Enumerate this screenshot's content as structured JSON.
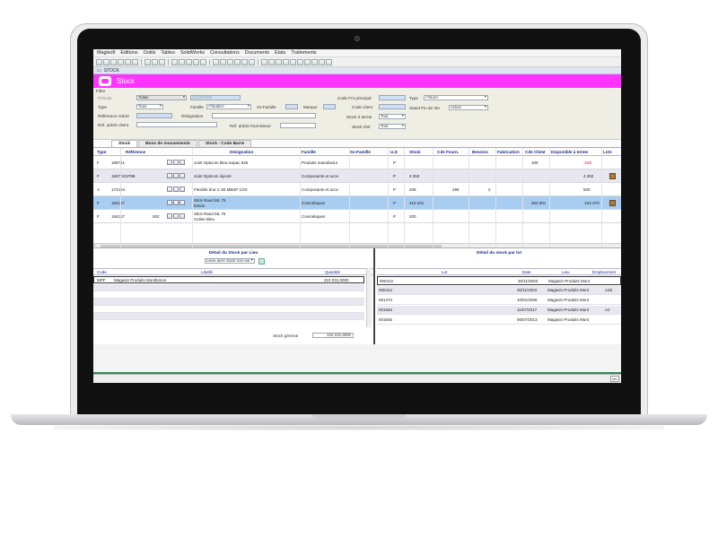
{
  "menu": [
    "Magisoft",
    "Editions",
    "Outils",
    "Tables",
    "SolidWorks",
    "Consultations",
    "Documents",
    "Etats",
    "Traitements"
  ],
  "window_title": "STOCK",
  "banner_title": "Stock",
  "filter": {
    "title": "Filtre",
    "periode_label": "Période",
    "periode_value": "Totale",
    "date_value": "31/12/2009",
    "code_fnr_label": "Code Fnr principal",
    "type_label": "Type",
    "type_value": "Tous",
    "famille_label": "Famille",
    "famille_value": "<Toutes>",
    "sous_famille_label": "Ss-Famille",
    "marque_label": "Marque",
    "code_client_label": "Code client",
    "type2_label": "Type",
    "type2_value": "<Tous>",
    "statut_label": "Statut Fin de Vie",
    "statut_value": "Active",
    "ref_article_label": "Référence Article",
    "designation_label": "Désignation",
    "stock_terme_label": "Stock à terme",
    "stock_terme_value": "Tout",
    "ref_client_label": "Ref. article client",
    "ref_fournisseur_label": "Ref. article fournisseur",
    "stock_reel_label": "Stock réel",
    "stock_reel_value": "Tout"
  },
  "tabs": [
    "Stock",
    "Bons de mouvements",
    "Stock - Code Barre"
  ],
  "grid": {
    "headers": [
      "Type",
      "Référence",
      "Désignation",
      "Famille",
      "Ss-Famille",
      "U.D",
      "Stock",
      "Cde Fourn.",
      "Besoins",
      "Fabrication",
      "Cde Client",
      "Disponible à terme",
      "Lots"
    ],
    "rows": [
      {
        "type": "F",
        "ref": "169751",
        "ref2": "",
        "designation": "Joint Opticom bleu isopac 525",
        "designation2": "",
        "famille": "Produits manufactur",
        "ud": "P",
        "stock": "",
        "cde_fourn": "",
        "besoins": "",
        "fabrication": "",
        "cde_client": "100",
        "dispo": "-100",
        "dispo_negative": true,
        "lots": false
      },
      {
        "type": "F",
        "ref": "1697A01P0B",
        "ref2": "",
        "designation": "Joint Opticom injecté",
        "designation2": "",
        "famille": "Composants et acce",
        "ud": "P",
        "stock": "4 250",
        "cde_fourn": "",
        "besoins": "",
        "fabrication": "",
        "cde_client": "",
        "dispo": "4 250",
        "dispo_negative": false,
        "lots": true
      },
      {
        "type": "A",
        "ref": "172464",
        "ref2": "",
        "designation": "Flexible brut C 90 MBSP 1/2X",
        "designation2": "",
        "famille": "Composants et acce",
        "ud": "P",
        "stock": "208",
        "cde_fourn": "296",
        "besoins": "2",
        "fabrication": "",
        "cde_client": "",
        "dispo": "500",
        "dispo_negative": false,
        "lots": false
      },
      {
        "type": "F",
        "ref": "184187",
        "ref2": "",
        "designation": "Stick Rand ML 75",
        "designation2": "Estine",
        "famille": "Cosmétiques",
        "ud": "P",
        "stock": "210 231",
        "cde_fourn": "",
        "besoins": "",
        "fabrication": "",
        "cde_client": "362 901",
        "dispo": "-152 670",
        "dispo_negative": false,
        "lots": true
      },
      {
        "type": "F",
        "ref": "184187",
        "ref2": "002",
        "designation": "Stick Rand ML 75",
        "designation2": "Celine Bleu",
        "famille": "Cosmétiques",
        "ud": "P",
        "stock": "200",
        "cde_fourn": "",
        "besoins": "",
        "fabrication": "",
        "cde_client": "",
        "dispo": "",
        "dispo_negative": false,
        "lots": false
      }
    ]
  },
  "detail_lieu": {
    "title": "Détail du Stock par Lieu",
    "filter_value": "Lieux avec stock non-nul",
    "headers": [
      "Code",
      "Libellé",
      "Quantité"
    ],
    "rows": [
      {
        "code": "MPF",
        "libelle": "Magasin Produits Montbrison",
        "quantite": "210 231,0000"
      }
    ],
    "total_label": "Stock général",
    "total_value": "210 231,0000"
  },
  "detail_lot": {
    "title": "Détail du stock par lot",
    "headers": [
      "Lot",
      "Date",
      "Lieu",
      "Emplacemen"
    ],
    "rows": [
      {
        "lot": "000412",
        "date": "30/11/2003",
        "lieu": "Magasin Produits Mont",
        "emplacement": ""
      },
      {
        "lot": "000412",
        "date": "30/11/2003",
        "lieu": "Magasin Produits Mont",
        "emplacement": "A28"
      },
      {
        "lot": "001473",
        "date": "10/01/2008",
        "lieu": "Magasin Produits Mont",
        "emplacement": ""
      },
      {
        "lot": "001846",
        "date": "11/07/2017",
        "lieu": "Magasin Produits Mont",
        "emplacement": "A2"
      },
      {
        "lot": "001846",
        "date": "06/07/2013",
        "lieu": "Magasin Produits Mont",
        "emplacement": ""
      }
    ]
  },
  "status": {
    "key_label": "Ver"
  },
  "colors": {
    "banner": "#ff33ff",
    "selected_row": "#a8cdf0",
    "header_text": "#1a2a8a",
    "negative": "#e00000"
  }
}
